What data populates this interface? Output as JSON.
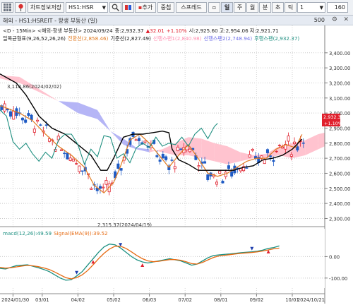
{
  "toolbar": {
    "menu_icon": "grid-menu-icon",
    "title_button": "차트정보저장",
    "symbol": "HS1:HSR",
    "add_label": "추가",
    "overlap_label": "중첩",
    "spread_label": "스프레드",
    "period_buttons": [
      "일",
      "주",
      "월",
      "분",
      "초",
      "틱"
    ],
    "active_period": "일",
    "interval_value": "1",
    "count_value": "160",
    "total_value": "500"
  },
  "window_title": "해외 - HS1:HSREIT - 항생 부동산 (일)",
  "legend_line": {
    "prefix": "<D - 15Min> <해외-항생 부동산>",
    "date": "2024/09/24",
    "close_label": "종:2,932.37",
    "change": "▲32.01",
    "change_pct": "+1.10%",
    "open": "시:2,925.60",
    "high": "고:2,954.06",
    "low": "저:2,921.71"
  },
  "ichimoku_legend": {
    "name": "일목균형표(9,26,52,26,26)",
    "conversion": "전환선(2,858.46)",
    "base": "기준선(2,827.49)",
    "span_a": "선행스팬1(2,840.98)",
    "span_b": "선행스팬2(2,748.94)",
    "lagging": "후행스팬(2,932.37)"
  },
  "colors": {
    "conversion": "#e07a20",
    "base": "#000000",
    "span_a": "#ff8fb0",
    "span_b": "#6f6fe8",
    "lagging": "#1f8f80",
    "cloud_bull": "#ffc3cf",
    "cloud_bear": "#b5b5f6",
    "up_candle": "#e0202d",
    "down_candle": "#1f5bc4",
    "macd": "#1b8f80",
    "signal": "#e66a12"
  },
  "annotations": {
    "high_mark": "3,110.86(2024/02/02)",
    "low_mark": "2,315.37(2024/04/19)"
  },
  "price_labels": {
    "last": "2,932.37",
    "last_pct": "+1.10%"
  },
  "macd_legend": {
    "macd": "macd(12,26):49.59",
    "signal": "Signal(EMA(9)):39.52"
  },
  "chart_data": [
    {
      "type": "candlestick",
      "title": "해외 - HS1:HSREIT - 항생 부동산 (일)",
      "y_ticks": [
        "3,400.00",
        "3,300.00",
        "3,200.00",
        "3,100.00",
        "3,000.00",
        "2,900.00",
        "2,800.00",
        "2,700.00",
        "2,600.00",
        "2,500.00",
        "2,400.00",
        "2,300.00"
      ],
      "ylim": [
        2260,
        3460
      ],
      "x_ticks": [
        "2024/01/30",
        "03/01",
        "04/02",
        "05/02",
        "06/03",
        "07/02",
        "08/01",
        "09/02",
        "10/01",
        "2024/10/21"
      ],
      "last_close": 2932.37,
      "series": [
        {
          "name": "전환선",
          "points": [
            [
              0,
              3050
            ],
            [
              6,
              3000
            ],
            [
              10,
              2950
            ],
            [
              14,
              2860
            ],
            [
              18,
              2780
            ],
            [
              22,
              2720
            ],
            [
              26,
              2640
            ],
            [
              29,
              2520
            ],
            [
              32,
              2470
            ],
            [
              35,
              2540
            ],
            [
              37,
              2640
            ],
            [
              40,
              2820
            ],
            [
              43,
              2860
            ],
            [
              46,
              2800
            ],
            [
              49,
              2720
            ],
            [
              52,
              2640
            ],
            [
              55,
              2720
            ],
            [
              58,
              2790
            ],
            [
              61,
              2700
            ],
            [
              64,
              2600
            ],
            [
              67,
              2580
            ],
            [
              70,
              2600
            ],
            [
              73,
              2640
            ],
            [
              76,
              2680
            ],
            [
              79,
              2700
            ],
            [
              82,
              2700
            ],
            [
              85,
              2760
            ],
            [
              88,
              2790
            ],
            [
              91,
              2770
            ],
            [
              93,
              2858
            ]
          ]
        },
        {
          "name": "기준선",
          "points": [
            [
              0,
              3260
            ],
            [
              5,
              3200
            ],
            [
              8,
              3120
            ],
            [
              12,
              2980
            ],
            [
              16,
              2900
            ],
            [
              20,
              2860
            ],
            [
              24,
              2790
            ],
            [
              28,
              2720
            ],
            [
              31,
              2620
            ],
            [
              33,
              2620
            ],
            [
              35,
              2700
            ],
            [
              38,
              2840
            ],
            [
              41,
              2860
            ],
            [
              44,
              2860
            ],
            [
              47,
              2870
            ],
            [
              50,
              2880
            ],
            [
              52,
              2870
            ],
            [
              53,
              2760
            ],
            [
              55,
              2690
            ],
            [
              58,
              2660
            ],
            [
              61,
              2620
            ],
            [
              64,
              2620
            ],
            [
              68,
              2620
            ],
            [
              72,
              2620
            ],
            [
              75,
              2640
            ],
            [
              78,
              2650
            ],
            [
              81,
              2690
            ],
            [
              84,
              2700
            ],
            [
              87,
              2720
            ],
            [
              90,
              2760
            ],
            [
              93,
              2827
            ]
          ]
        },
        {
          "name": "후행스팬",
          "points": [
            [
              0,
              3020
            ],
            [
              2,
              2980
            ],
            [
              4,
              2810
            ],
            [
              6,
              2760
            ],
            [
              8,
              2800
            ],
            [
              10,
              2730
            ],
            [
              12,
              2680
            ],
            [
              14,
              2740
            ],
            [
              16,
              2700
            ],
            [
              18,
              2820
            ],
            [
              20,
              2860
            ],
            [
              22,
              2860
            ],
            [
              24,
              2790
            ],
            [
              26,
              2660
            ],
            [
              28,
              2760
            ],
            [
              30,
              2710
            ],
            [
              32,
              2850
            ],
            [
              34,
              2840
            ],
            [
              36,
              2700
            ],
            [
              38,
              2730
            ],
            [
              40,
              2670
            ],
            [
              42,
              2770
            ],
            [
              44,
              2800
            ],
            [
              46,
              2770
            ],
            [
              48,
              2840
            ],
            [
              50,
              2780
            ],
            [
              52,
              2800
            ],
            [
              54,
              2790
            ],
            [
              56,
              2840
            ],
            [
              58,
              2780
            ],
            [
              60,
              2860
            ],
            [
              62,
              2900
            ],
            [
              64,
              2830
            ],
            [
              66,
              2910
            ],
            [
              67,
              2932
            ]
          ]
        },
        {
          "name": "구름",
          "span_a": [
            [
              0,
              3250
            ],
            [
              6,
              3240
            ],
            [
              12,
              3160
            ],
            [
              18,
              3080
            ],
            [
              24,
              3000
            ],
            [
              30,
              2960
            ],
            [
              34,
              2880
            ],
            [
              38,
              2790
            ],
            [
              42,
              2760
            ],
            [
              46,
              2740
            ],
            [
              50,
              2760
            ],
            [
              54,
              2800
            ],
            [
              58,
              2840
            ],
            [
              62,
              2830
            ],
            [
              66,
              2800
            ],
            [
              70,
              2780
            ],
            [
              74,
              2740
            ],
            [
              78,
              2720
            ],
            [
              82,
              2730
            ],
            [
              86,
              2780
            ],
            [
              90,
              2800
            ],
            [
              94,
              2820
            ],
            [
              98,
              2860
            ],
            [
              100,
              2870
            ]
          ],
          "span_b": [
            [
              0,
              3230
            ],
            [
              6,
              3200
            ],
            [
              12,
              3140
            ],
            [
              18,
              3080
            ],
            [
              24,
              3070
            ],
            [
              30,
              3020
            ],
            [
              34,
              2880
            ],
            [
              38,
              2830
            ],
            [
              42,
              2770
            ],
            [
              46,
              2760
            ],
            [
              50,
              2740
            ],
            [
              54,
              2720
            ],
            [
              58,
              2720
            ],
            [
              62,
              2700
            ],
            [
              66,
              2680
            ],
            [
              70,
              2660
            ],
            [
              74,
              2680
            ],
            [
              78,
              2700
            ],
            [
              82,
              2700
            ],
            [
              86,
              2720
            ],
            [
              90,
              2700
            ],
            [
              94,
              2720
            ],
            [
              98,
              2760
            ],
            [
              100,
              2780
            ]
          ]
        }
      ]
    },
    {
      "type": "line",
      "title": "macd(12,26):49.59 Signal(EMA(9)):39.52",
      "y_ticks": [
        "0.00",
        "-100.00"
      ],
      "ylim": [
        -140,
        90
      ],
      "series": [
        {
          "name": "macd",
          "values": [
            -55,
            -58,
            -50,
            -42,
            -40,
            -38,
            -45,
            -52,
            -60,
            -70,
            -85,
            -100,
            -110,
            -108,
            -90,
            -70,
            -40,
            -10,
            20,
            45,
            58,
            55,
            40,
            20,
            0,
            -15,
            -25,
            -30,
            -25,
            -20,
            -15,
            -10,
            -15,
            -20,
            -30,
            -40,
            -35,
            -20,
            -5,
            5,
            8,
            10,
            12,
            15,
            18,
            20,
            22,
            25,
            30,
            38,
            42,
            49.59
          ]
        },
        {
          "name": "Signal",
          "values": [
            -50,
            -54,
            -52,
            -48,
            -44,
            -41,
            -43,
            -47,
            -53,
            -60,
            -72,
            -85,
            -98,
            -104,
            -98,
            -85,
            -65,
            -38,
            -10,
            15,
            35,
            48,
            48,
            38,
            22,
            5,
            -10,
            -20,
            -24,
            -22,
            -18,
            -14,
            -14,
            -17,
            -24,
            -33,
            -35,
            -27,
            -15,
            -4,
            3,
            6,
            9,
            12,
            15,
            17,
            19,
            22,
            26,
            31,
            36,
            39.52
          ]
        }
      ]
    }
  ]
}
